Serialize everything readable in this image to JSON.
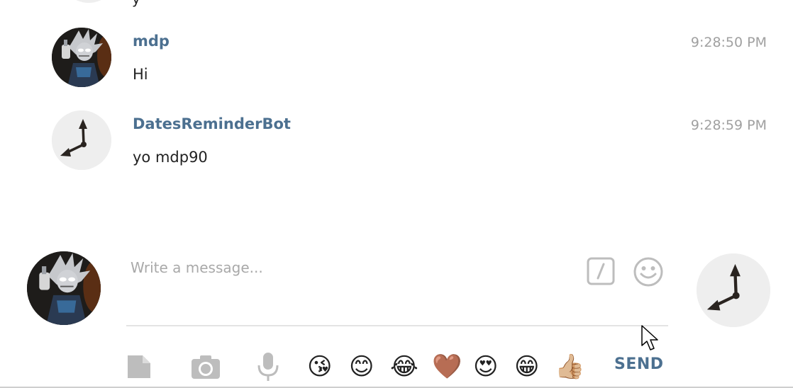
{
  "previous_message": {
    "text": "y"
  },
  "messages": [
    {
      "author": "mdp",
      "time": "9:28:50 PM",
      "text": "Hi",
      "avatar": "rick-avatar"
    },
    {
      "author": "DatesReminderBot",
      "time": "9:28:59 PM",
      "text": "yo mdp90",
      "avatar": "clock-avatar"
    }
  ],
  "composer": {
    "placeholder": "Write a message...",
    "send_label": "SEND"
  },
  "emojis": [
    "😘",
    "😊",
    "😂",
    "🤎",
    "😍",
    "😁",
    "👍🏼"
  ],
  "icons": {
    "attach": "file-icon",
    "camera": "camera-icon",
    "voice": "microphone-icon",
    "commands": "slash-command-icon",
    "emoji_picker": "smiley-icon"
  },
  "colors": {
    "author_name": "#4c7090",
    "timestamp": "#a0a0a0",
    "icon_gray": "#bdbdbd",
    "divider": "#e4e4e4"
  }
}
